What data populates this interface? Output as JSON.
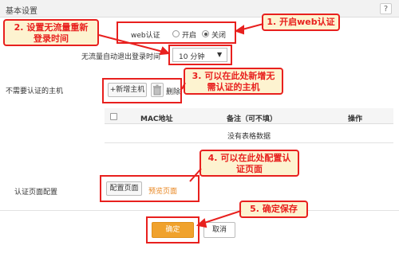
{
  "header": {
    "title": "基本设置",
    "help_label": "?"
  },
  "web_auth": {
    "label": "web认证",
    "on_label": "开启",
    "off_label": "关闭",
    "selected": "off"
  },
  "timeout": {
    "label": "无流量自动退出登录时间",
    "value": "10 分钟"
  },
  "exempt_hosts": {
    "label": "不需要认证的主机",
    "add_button": "+新增主机",
    "delete_button": "删除",
    "columns": [
      "MAC地址",
      "备注（可不填）",
      "操作"
    ],
    "empty_text": "没有表格数据"
  },
  "auth_page": {
    "label": "认证页面配置",
    "config_button": "配置页面",
    "preview_link": "预览页面"
  },
  "actions": {
    "ok": "确定",
    "cancel": "取消"
  },
  "callouts": {
    "c1": "1. 开启web认证",
    "c2": [
      "2. 设置无流量重新",
      "登录时间"
    ],
    "c3": [
      "3. 可以在此处新增无",
      "需认证的主机"
    ],
    "c4": [
      "4. 可以在此处配置认",
      "证页面"
    ],
    "c5": "5. 确定保存"
  },
  "colors": {
    "annotation_red": "#e8201e",
    "callout_bg": "#fdf3d0",
    "ok_orange": "#f0a22c",
    "preview_orange": "#e8851f"
  }
}
